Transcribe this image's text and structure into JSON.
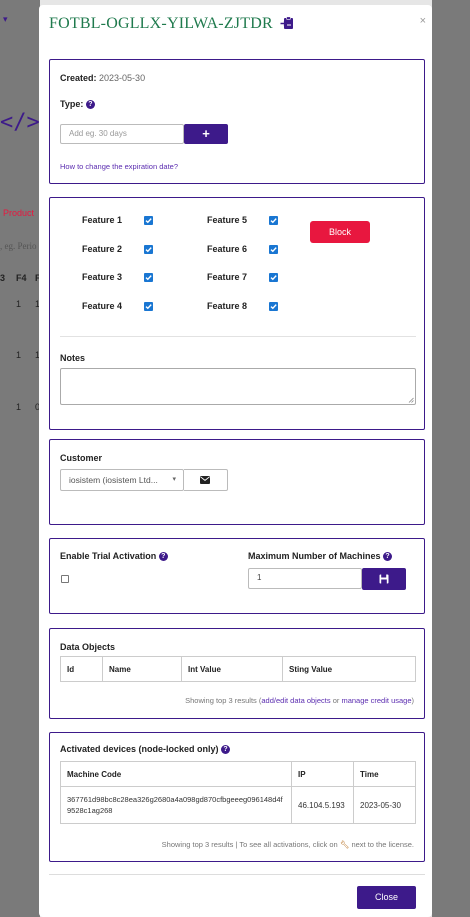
{
  "modal": {
    "title": "FOTBL-OGLLX-YILWA-ZJTDR",
    "close_glyph": "×",
    "icon": "clipboard-arrow-icon"
  },
  "background": {
    "code_glyph": "</>",
    "product_label": "Product",
    "search_placeholder": ", eg. Perio",
    "col_a": "3",
    "col_b": "F4",
    "col_c": "F",
    "row1": [
      "1",
      "1"
    ],
    "row2": [
      "1",
      "1"
    ],
    "row3": [
      "1",
      "0"
    ]
  },
  "expiry": {
    "created_label": "Created:",
    "created_value": "2023-05-30",
    "type_label": "Type:",
    "days_placeholder": "Add eg. 30 days",
    "add_glyph": "+",
    "help_link": "How to change the expiration date?"
  },
  "features": {
    "items": [
      {
        "label": "Feature 1",
        "checked": true
      },
      {
        "label": "Feature 2",
        "checked": true
      },
      {
        "label": "Feature 3",
        "checked": true
      },
      {
        "label": "Feature 4",
        "checked": true
      },
      {
        "label": "Feature 5",
        "checked": true
      },
      {
        "label": "Feature 6",
        "checked": true
      },
      {
        "label": "Feature 7",
        "checked": true
      },
      {
        "label": "Feature 8",
        "checked": true
      }
    ],
    "block_label": "Block",
    "notes_label": "Notes"
  },
  "customer": {
    "label": "Customer",
    "selected": "iosistem (iosistem Ltd...",
    "email_icon": "envelope-icon"
  },
  "trial": {
    "trial_label": "Enable Trial Activation",
    "trial_checked": false,
    "machines_label": "Maximum Number of Machines",
    "machines_value": "1",
    "save_icon": "floppy-icon"
  },
  "data_objects": {
    "title": "Data Objects",
    "columns": [
      "Id",
      "Name",
      "Int Value",
      "Sting Value"
    ],
    "note_prefix": "Showing top 3 results (",
    "link1": "add/edit data objects",
    "note_mid": " or ",
    "link2": "manage credit usage",
    "note_suffix": ")"
  },
  "devices": {
    "title": "Activated devices (node-locked only)",
    "columns": [
      "Machine Code",
      "IP",
      "Time"
    ],
    "rows": [
      {
        "code": "367761d98bc8c28ea326g2680a4a098gd870cfbgeeeg096148d4f9528c1ag268",
        "ip": "46.104.5.193",
        "time": "2023-05-30"
      }
    ],
    "note_prefix": "Showing top 3 results | To see all activations, click on",
    "note_suffix": "next to the license."
  },
  "footer": {
    "close_label": "Close"
  },
  "colors": {
    "brand_purple": "#3d1a8a",
    "title_green": "#1f7a4d",
    "danger_red": "#e8173f",
    "checkbox_blue": "#1976d2"
  }
}
